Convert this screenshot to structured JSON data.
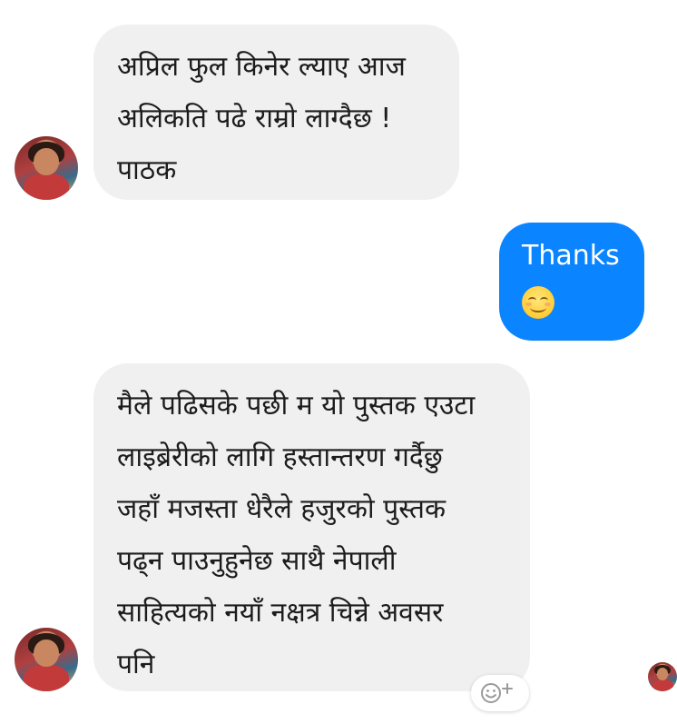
{
  "messages": [
    {
      "direction": "incoming",
      "lines": [
        "अप्रिल फुल किनेर ल्याए आज",
        "अलिकति पढे राम्रो लाग्दैछ !",
        "पाठक"
      ]
    },
    {
      "direction": "outgoing",
      "lines": [
        "Thanks"
      ],
      "emoji": "smiling-face-emoji"
    },
    {
      "direction": "incoming",
      "lines": [
        "मैले पढिसके पछी म यो पुस्तक एउटा",
        "लाइब्रेरीको लागि हस्तान्तरण गर्दैछु",
        "जहाँ मजस्ता धेरैले हजुरको पुस्तक",
        "पढ्न पाउनुहुनेछ साथै नेपाली",
        "साहित्यको नयाँ नक्षत्र चिन्ने अवसर",
        "पनि"
      ]
    }
  ],
  "icons": {
    "reaction": "add-reaction-icon",
    "avatar": "contact-avatar",
    "read_receipt": "seen-avatar"
  },
  "colors": {
    "incoming_bubble": "#f0f0f0",
    "outgoing_bubble": "#0b84ff",
    "outgoing_text": "#ffffff",
    "incoming_text": "#1c1c1c"
  }
}
